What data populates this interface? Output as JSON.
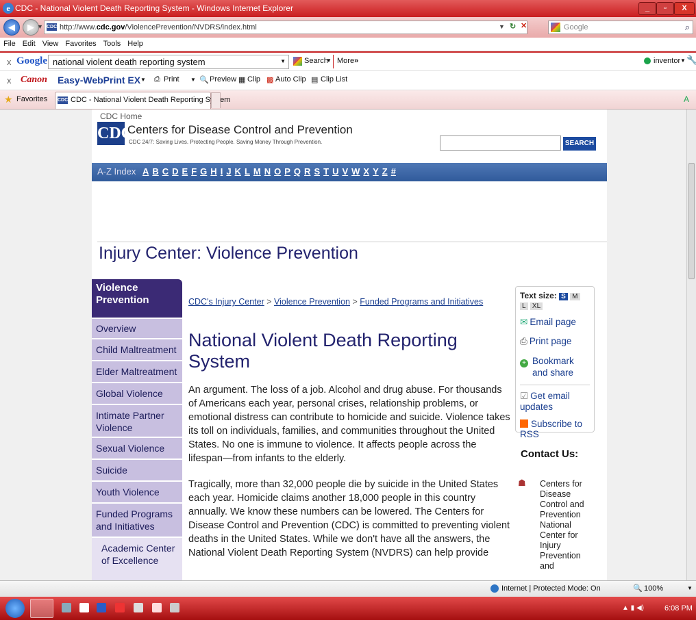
{
  "window": {
    "title": "CDC - National Violent Death Reporting System - Windows Internet Explorer",
    "min": "_",
    "max": "▫",
    "close": "X"
  },
  "browser": {
    "url_pre": "http://www.",
    "url_host": "cdc.gov",
    "url_path": "/ViolencePrevention/NVDRS/index.html",
    "search_engine": "Google",
    "menu": [
      "File",
      "Edit",
      "View",
      "Favorites",
      "Tools",
      "Help"
    ],
    "google_bar": {
      "x": "x",
      "logo": "Google",
      "query": "national violent death reporting system",
      "search": "Search",
      "more": "More",
      "more_arrows": "»",
      "user": "inventor"
    },
    "canon_bar": {
      "x": "x",
      "brand": "Canon",
      "product": "Easy-WebPrint EX",
      "print": "Print",
      "preview": "Preview",
      "clip": "Clip",
      "auto_clip": "Auto Clip",
      "clip_list": "Clip List"
    },
    "favorites": "Favorites",
    "tab_title": "CDC - National Violent Death Reporting System",
    "favicon": "CDC",
    "status_text": "Internet | Protected Mode: On",
    "zoom": "100%",
    "clock": "6:08 PM"
  },
  "cdc": {
    "home": "CDC Home",
    "logo": "CDC",
    "org": "Centers for Disease Control and Prevention",
    "tagline": "CDC 24/7: Saving Lives. Protecting People. Saving Money Through Prevention.",
    "search_button": "SEARCH",
    "az_label": "A-Z Index",
    "az_letters": [
      "A",
      "B",
      "C",
      "D",
      "E",
      "F",
      "G",
      "H",
      "I",
      "J",
      "K",
      "L",
      "M",
      "N",
      "O",
      "P",
      "Q",
      "R",
      "S",
      "T",
      "U",
      "V",
      "W",
      "X",
      "Y",
      "Z",
      "#"
    ],
    "section_title": "Injury Center: Violence Prevention"
  },
  "sidebar": {
    "header": "Violence Prevention",
    "items": [
      "Overview",
      "Child Maltreatment",
      "Elder Maltreatment",
      "Global Violence",
      "Intimate Partner Violence",
      "Sexual Violence",
      "Suicide",
      "Youth Violence",
      "Funded Programs and Initiatives"
    ],
    "sub": "Academic Center of Excellence"
  },
  "breadcrumb": {
    "c1": "CDC's Injury Center",
    "c2": "Violence Prevention",
    "c3": "Funded Programs and Initiatives",
    "sep": ">"
  },
  "article": {
    "title": "National Violent Death Reporting System",
    "p1": "An argument. The loss of a job. Alcohol and drug abuse. For thousands of Americans each year, personal crises, relationship problems, or emotional distress can contribute to homicide and suicide. Violence takes its toll on individuals, families, and communities throughout the United States. No one is immune to violence. It affects people across the lifespan—from infants to the elderly.",
    "p2": "Tragically, more than 32,000 people die by suicide in the United States each year. Homicide claims another 18,000 people in this country annually.  We know these numbers can be lowered. The Centers for Disease Control and Prevention (CDC) is committed to preventing violent deaths in the United States.  While we don't have all the answers, the National Violent Death Reporting System (NVDRS) can help provide"
  },
  "tools": {
    "text_size": "Text size:",
    "sizes": [
      "S",
      "M",
      "L",
      "XL"
    ],
    "email": "Email page",
    "print": "Print page",
    "bookmark": "Bookmark and share",
    "updates": "Get email updates",
    "rss": "Subscribe to RSS"
  },
  "contact": {
    "title": "Contact Us:",
    "text": "Centers for Disease Control and Prevention National Center for Injury Prevention and"
  }
}
